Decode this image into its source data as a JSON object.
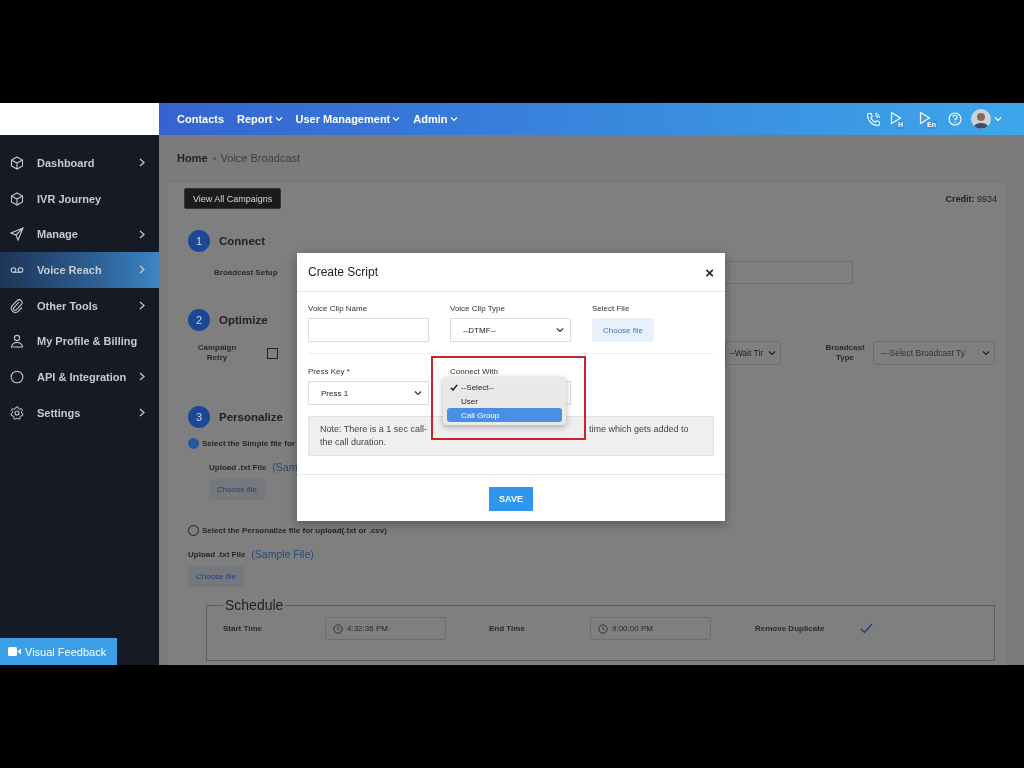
{
  "topbar": {
    "nav": [
      {
        "label": "Contacts",
        "dropdown": false
      },
      {
        "label": "Report",
        "dropdown": true
      },
      {
        "label": "User Management",
        "dropdown": true
      },
      {
        "label": "Admin",
        "dropdown": true
      }
    ],
    "icons": [
      {
        "kind": "phone"
      },
      {
        "kind": "play",
        "badge": "H"
      },
      {
        "kind": "play",
        "badge": "En"
      },
      {
        "kind": "help"
      },
      {
        "kind": "avatar"
      }
    ]
  },
  "sidebar": {
    "items": [
      {
        "label": "Dashboard",
        "chevron": true,
        "selected": false
      },
      {
        "label": "IVR Journey",
        "chevron": false,
        "selected": false
      },
      {
        "label": "Manage",
        "chevron": true,
        "selected": false
      },
      {
        "label": "Voice Reach",
        "chevron": true,
        "selected": true
      },
      {
        "label": "Other Tools",
        "chevron": true,
        "selected": false
      },
      {
        "label": "My Profile & Billing",
        "chevron": false,
        "selected": false
      },
      {
        "label": "API & Integration",
        "chevron": true,
        "selected": false
      },
      {
        "label": "Settings",
        "chevron": true,
        "selected": false
      }
    ],
    "feedback_button": "Visual Feedback"
  },
  "breadcrumb": [
    "Home",
    "Voice Broadcast"
  ],
  "page": {
    "view_all_button": "View All Campaigns",
    "credit_label": "Credit:",
    "credit_value": "9934",
    "steps": [
      {
        "number": "1",
        "title": "Connect"
      },
      {
        "number": "2",
        "title": "Optimize"
      },
      {
        "number": "3",
        "title": "Personalize"
      }
    ],
    "broadcast_setup_label": "Broadcast Setup",
    "campaign_retry": {
      "label": "Campaign Retry",
      "checked": false
    },
    "wait_time_select": "--Wait Tir",
    "broadcast_type": {
      "label": "Broadcast Type",
      "placeholder": "---Select Broadcast Ty"
    },
    "upload_options": [
      {
        "label": "Select the Simple file for",
        "selected": true,
        "upload_label": "Upload .txt File",
        "sample_link": "(Sam",
        "button": "Choose file"
      },
      {
        "label": "Select the Personalize file for upload(.txt or .csv)",
        "selected": false,
        "upload_label": "Upload .txt File",
        "sample_link": "(Sample File)",
        "button": "Choose file"
      }
    ],
    "schedule": {
      "title": "Schedule",
      "start_label": "Start Time",
      "start_value": "4:32:36 PM",
      "end_label": "End Time",
      "end_value": "9:00:00 PM",
      "remove_duplicate_label": "Remove Duplicate",
      "remove_duplicate": true
    }
  },
  "modal": {
    "title": "Create Script",
    "close": "×",
    "rows": [
      [
        {
          "kind": "input",
          "label": "Voice Clip Name"
        },
        {
          "kind": "select",
          "label": "Voice Clip Type",
          "value": "--DTMF--"
        },
        {
          "kind": "file",
          "label": "Select File",
          "button": "Choose file"
        }
      ],
      [
        {
          "kind": "select",
          "label": "Press Key *",
          "value": "Press 1"
        },
        {
          "kind": "select",
          "label": "Connect With",
          "open": true,
          "highlighted": true,
          "options": [
            {
              "label": "--Select--",
              "checked": true,
              "selected": false
            },
            {
              "label": "User",
              "checked": false,
              "selected": false
            },
            {
              "label": "Call Group",
              "checked": false,
              "selected": true
            }
          ]
        }
      ]
    ],
    "note_parts": [
      "Note: There is a 1 sec call-",
      "time which gets added to the call duration."
    ],
    "save_button": "SAVE"
  }
}
